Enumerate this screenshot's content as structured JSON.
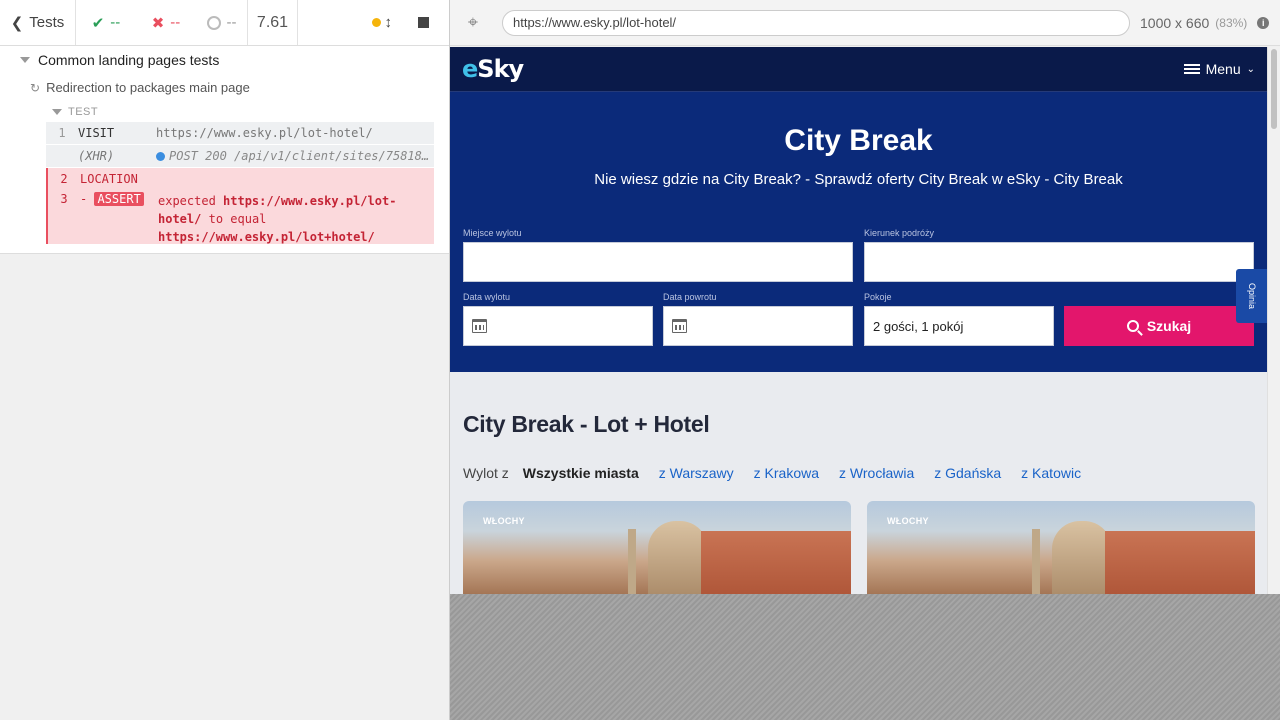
{
  "reporter": {
    "header": {
      "tests_label": "Tests",
      "passed": "--",
      "failed": "--",
      "pending": "--",
      "duration": "7.61"
    },
    "suite_title": "Common landing pages tests",
    "test_title": "Redirection to packages main page",
    "test_section_label": "TEST",
    "commands": {
      "visit": {
        "num": "1",
        "name": "VISIT",
        "message": "https://www.esky.pl/lot-hotel/"
      },
      "xhr": {
        "name": "(XHR)",
        "message": "POST 200 /api/v1/client/sites/75818..."
      },
      "location": {
        "num": "2",
        "name": "LOCATION"
      },
      "assert": {
        "num": "3",
        "badge": "ASSERT",
        "expected_word": "expected",
        "actual_url": "https://www.esky.pl/lot-hotel/",
        "to_equal": "to equal",
        "expected_url": "https://www.esky.pl/lot+hotel/"
      }
    }
  },
  "aut": {
    "url": "https://www.esky.pl/lot-hotel/",
    "viewport": "1000 x 660",
    "scale": "(83%)"
  },
  "site": {
    "logo_e": "e",
    "logo_rest": "Sky",
    "menu_label": "Menu",
    "hero_title": "City Break",
    "hero_subtitle": "Nie wiesz gdzie na City Break? - Sprawdź oferty City Break w eSky - City Break",
    "form": {
      "departure_label": "Miejsce wylotu",
      "destination_label": "Kierunek podróży",
      "departure_date_label": "Data wylotu",
      "return_date_label": "Data powrotu",
      "rooms_label": "Pokoje",
      "rooms_value": "2 gości, 1 pokój",
      "search_label": "Szukaj"
    },
    "feedback_tab": "Opinia",
    "section_title": "City Break - Lot + Hotel",
    "cities": {
      "prefix": "Wylot z",
      "active": "Wszystkie miasta",
      "links": [
        "z Warszawy",
        "z Krakowa",
        "z Wrocławia",
        "z Gdańska",
        "z Katowic"
      ]
    },
    "cards": [
      {
        "country": "WŁOCHY"
      },
      {
        "country": "WŁOCHY"
      }
    ]
  },
  "colors": {
    "passed": "#2a9e57",
    "failed": "#e94f5f",
    "hero_bg": "#0b2a7a",
    "nav_bg": "#0a1a4a",
    "search_btn": "#e3166c",
    "link": "#1a63c8"
  }
}
